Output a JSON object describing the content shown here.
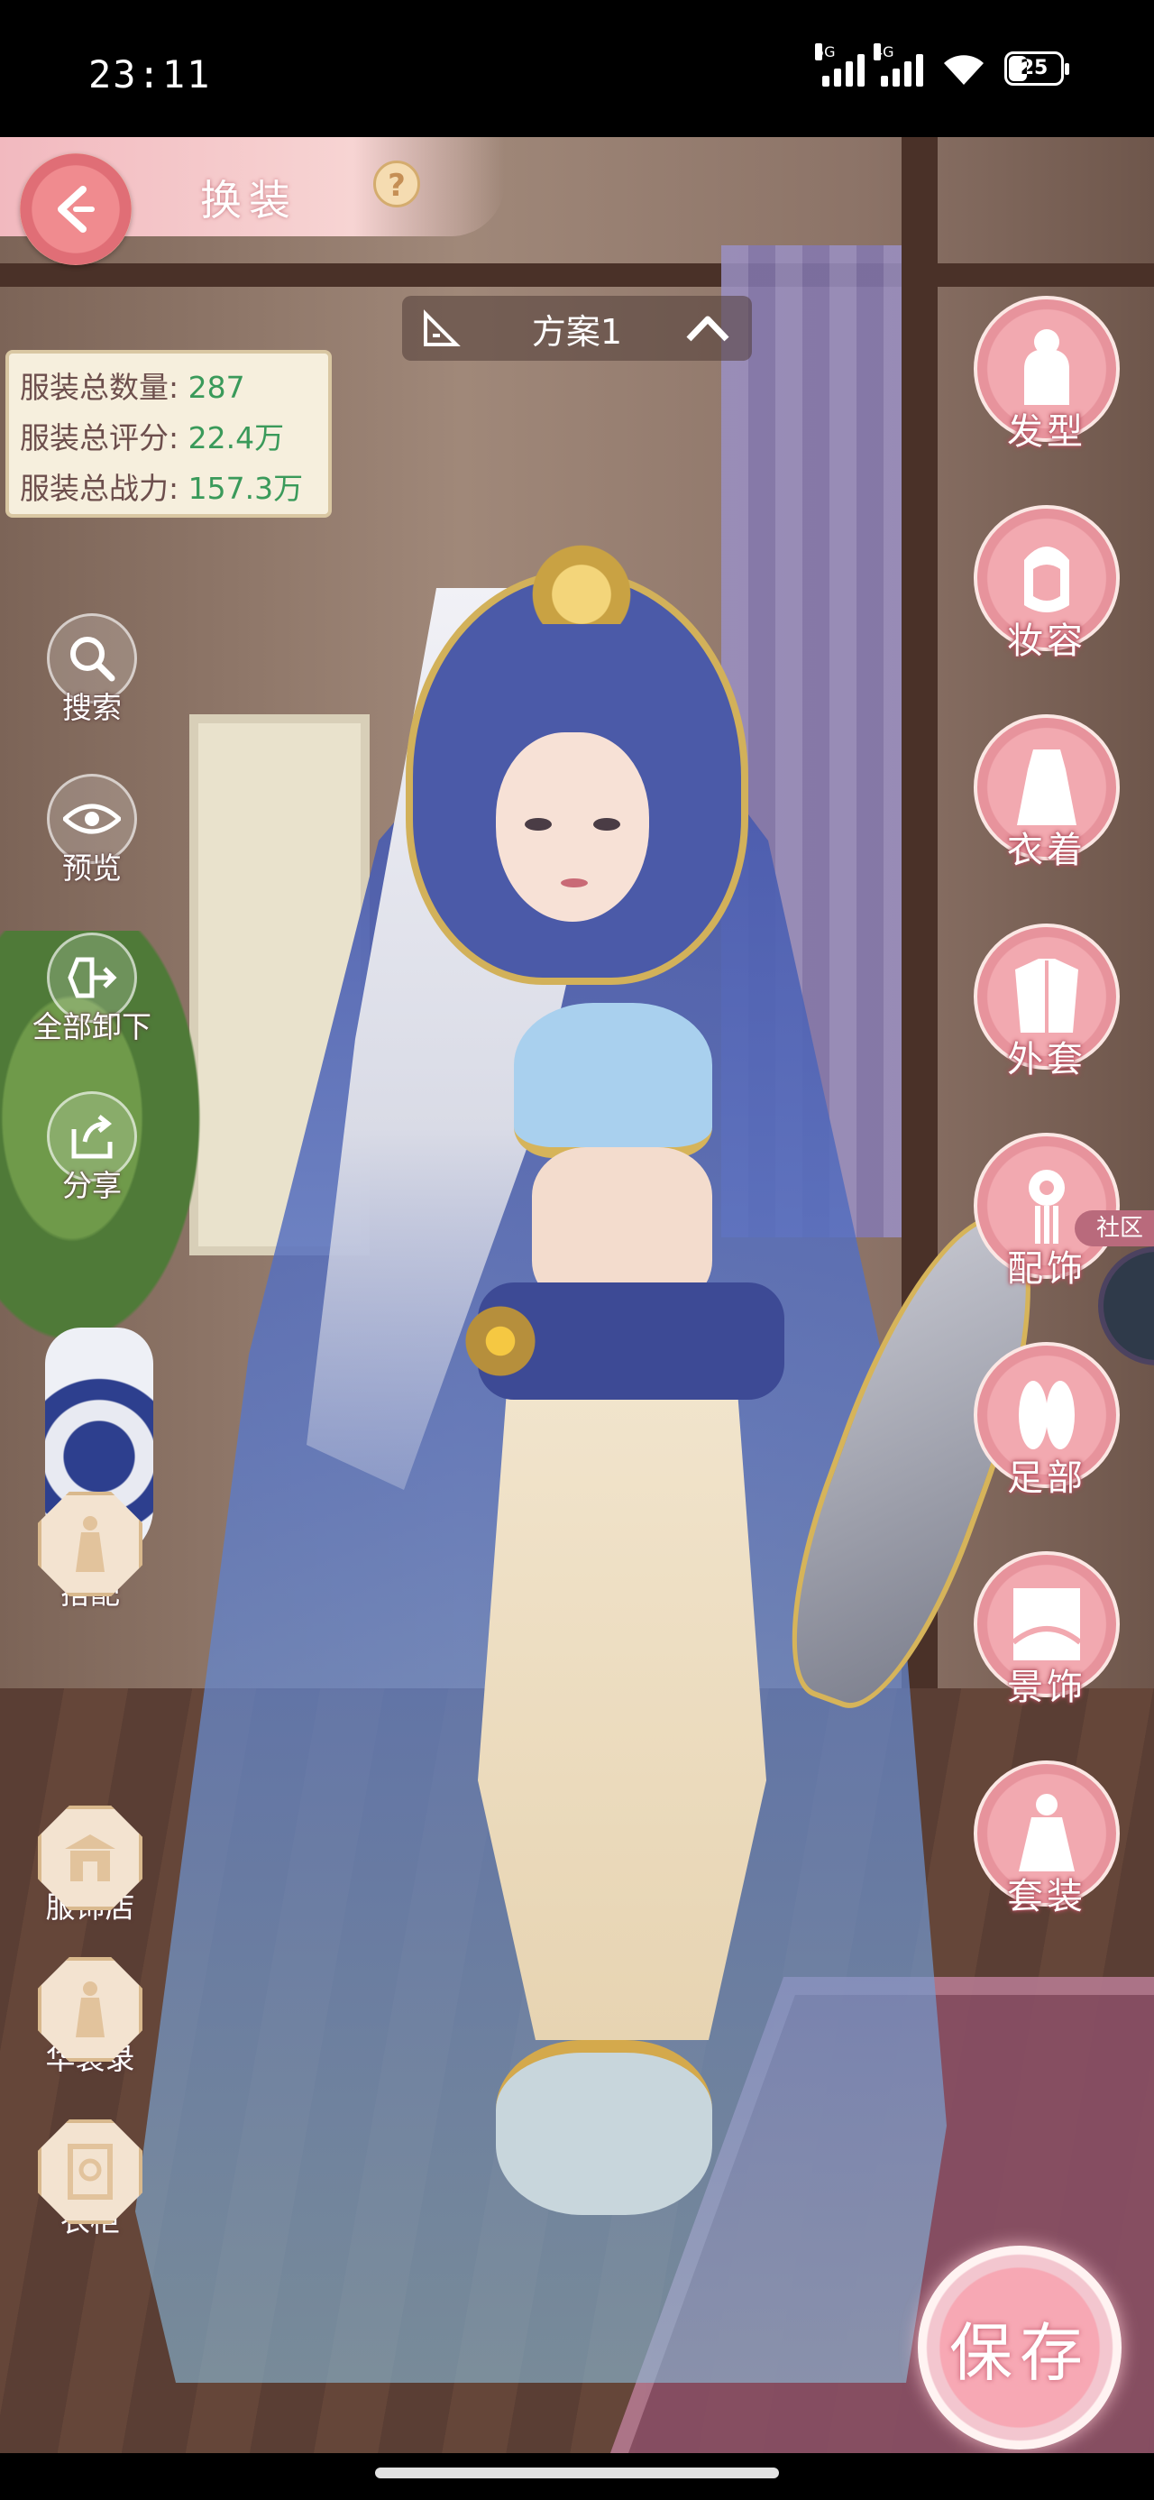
{
  "status_bar": {
    "time": "23:11",
    "battery": "25",
    "net1": "5G",
    "net2": "4G"
  },
  "header": {
    "title": "换装",
    "help_label": "?"
  },
  "scheme": {
    "label": "方案1"
  },
  "stats": [
    {
      "label": "服装总数量:",
      "value": "287"
    },
    {
      "label": "服装总评分:",
      "value": "22.4万"
    },
    {
      "label": "服装总战力:",
      "value": "157.3万"
    }
  ],
  "left_tools": [
    {
      "label": "搜索",
      "icon": "search-icon"
    },
    {
      "label": "预览",
      "icon": "eye-icon"
    },
    {
      "label": "全部卸下",
      "icon": "remove-all-icon"
    },
    {
      "label": "分享",
      "icon": "share-icon"
    },
    {
      "label": "搭配",
      "icon": "outfit-match-icon"
    },
    {
      "label": "服饰店",
      "icon": "shop-icon"
    },
    {
      "label": "华装录",
      "icon": "gallery-icon"
    },
    {
      "label": "衣柜",
      "icon": "wardrobe-icon"
    }
  ],
  "categories": [
    {
      "label": "发型",
      "icon": "hairstyle-icon"
    },
    {
      "label": "妆容",
      "icon": "makeup-icon"
    },
    {
      "label": "衣着",
      "icon": "clothing-icon"
    },
    {
      "label": "外套",
      "icon": "coat-icon"
    },
    {
      "label": "配饰",
      "icon": "accessory-icon"
    },
    {
      "label": "足部",
      "icon": "shoes-icon"
    },
    {
      "label": "景饰",
      "icon": "scene-decor-icon"
    },
    {
      "label": "套装",
      "icon": "suit-icon"
    }
  ],
  "community": {
    "label": "社区"
  },
  "save": {
    "label": "保存"
  },
  "colors": {
    "accent_pink": "#f2a9b0",
    "value_green": "#3a9a5a",
    "stat_label": "#6d4f4d"
  }
}
